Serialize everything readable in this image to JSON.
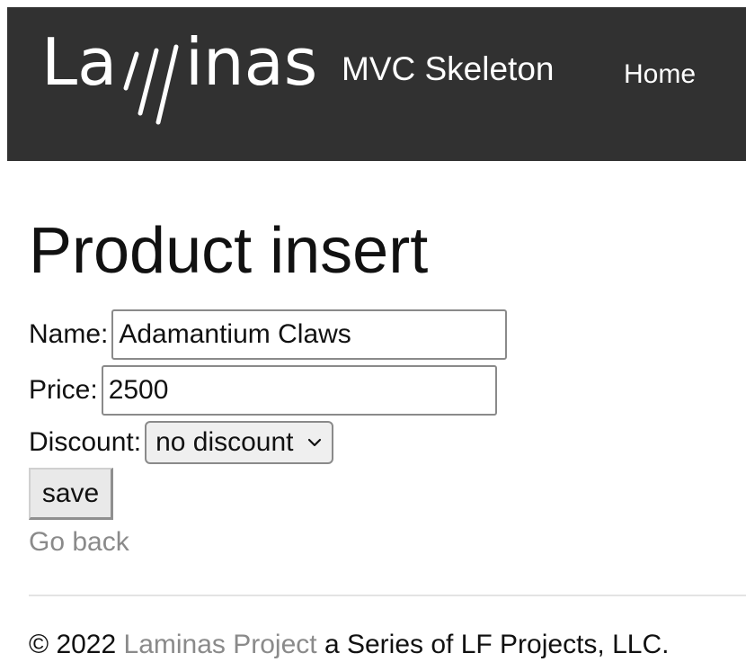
{
  "navbar": {
    "logo_text": "Laminas",
    "brand_sub": "MVC Skeleton",
    "home_label": "Home"
  },
  "page": {
    "title": "Product insert"
  },
  "form": {
    "name_label": "Name:",
    "name_value": "Adamantium Claws",
    "price_label": "Price:",
    "price_value": "2500",
    "discount_label": "Discount:",
    "discount_selected": "no discount",
    "save_label": "save",
    "go_back_label": "Go back"
  },
  "footer": {
    "prefix": "© 2022 ",
    "link_text": "Laminas Project",
    "suffix": " a Series of LF Projects, LLC."
  },
  "colors": {
    "navbar_bg": "#313131",
    "link_gray": "#8a8a8a"
  },
  "icons": {
    "select_arrow": "chevron-down-icon"
  }
}
